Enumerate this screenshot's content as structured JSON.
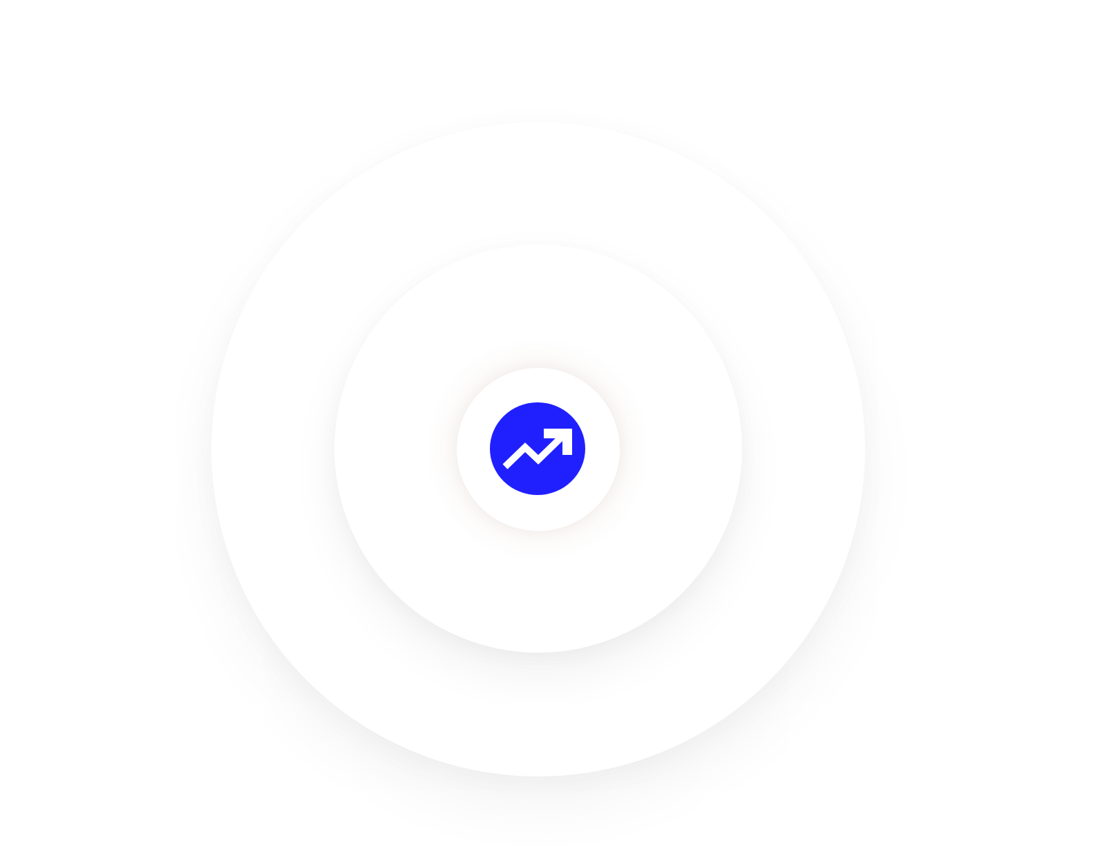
{
  "colors": {
    "background": "#ffffff",
    "ring": "#ffffff",
    "accent": "#2020ff",
    "icon": "#ffffff"
  },
  "icons": {
    "center": "trending-up-icon"
  }
}
